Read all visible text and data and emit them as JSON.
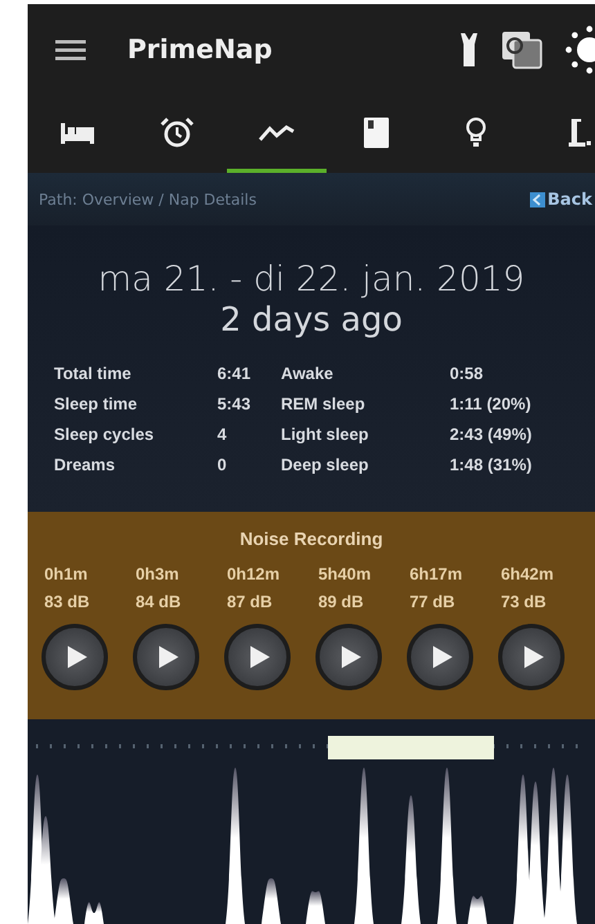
{
  "app_bar": {
    "title": "PrimeNap"
  },
  "tabs": [
    {
      "kind": "bed",
      "selected": false
    },
    {
      "kind": "alarm",
      "selected": false
    },
    {
      "kind": "graph",
      "selected": true
    },
    {
      "kind": "book",
      "selected": false
    },
    {
      "kind": "bulb",
      "selected": false
    },
    {
      "kind": "sign",
      "selected": false
    }
  ],
  "breadcrumb": {
    "path": "Path: Overview / Nap Details",
    "back": "Back"
  },
  "nap": {
    "date": "ma 21. - di 22. jan. 2019",
    "ago": "2 days ago"
  },
  "stats": [
    {
      "label": "Total time",
      "value": "6:41",
      "label_2": "Awake",
      "value_2": "0:58"
    },
    {
      "label": "Sleep time",
      "value": "5:43",
      "label_2": "REM sleep",
      "value_2": "1:11 (20%)"
    },
    {
      "label": "Sleep cycles",
      "value": "4",
      "label_2": "Light sleep",
      "value_2": "2:43 (49%)"
    },
    {
      "label": "Dreams",
      "value": "0",
      "label_2": "Deep sleep",
      "value_2": "1:48 (31%)"
    }
  ],
  "noise_recording": {
    "title": "Noise Recording",
    "clips": [
      {
        "time": "0h1m",
        "loudness": "83 dB"
      },
      {
        "time": "0h3m",
        "loudness": "84 dB"
      },
      {
        "time": "0h12m",
        "loudness": "87 dB"
      },
      {
        "time": "5h40m",
        "loudness": "89 dB"
      },
      {
        "time": "6h17m",
        "loudness": "77 dB"
      },
      {
        "time": "6h42m",
        "loudness": "73 dB"
      }
    ]
  }
}
